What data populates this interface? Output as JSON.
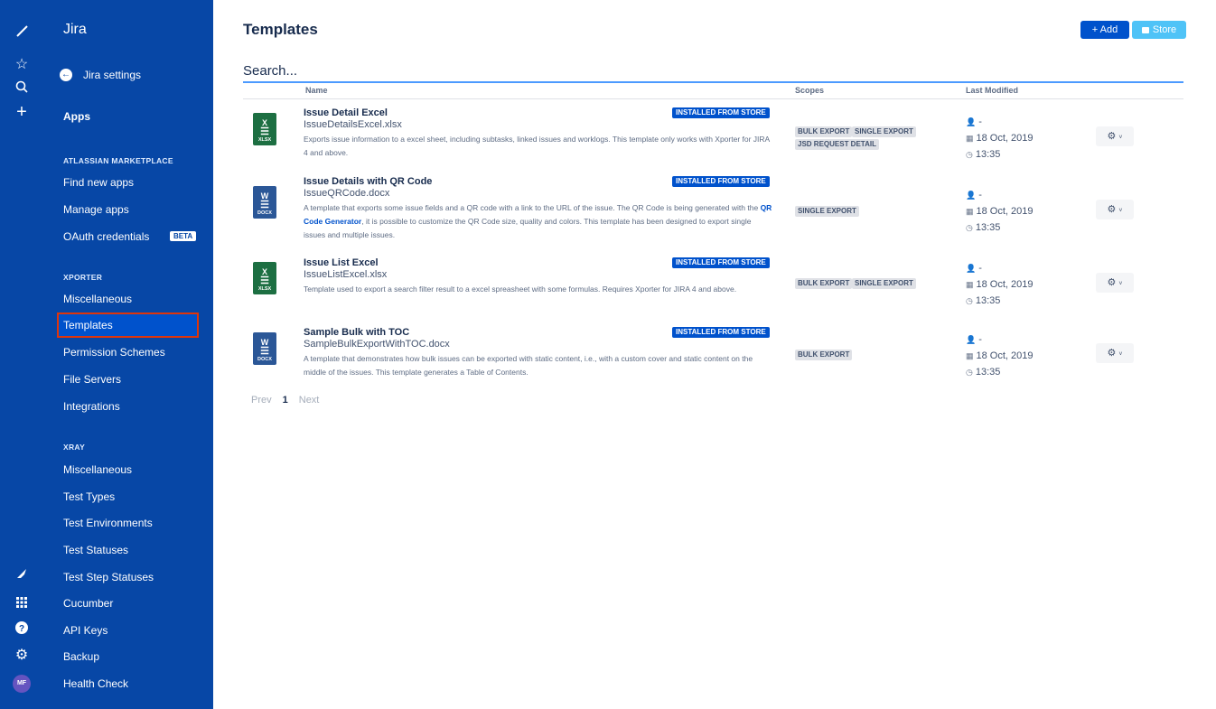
{
  "rail": {
    "icons": [
      "jira-logo-icon",
      "star-icon",
      "search-icon",
      "plus-icon",
      "rocket-icon",
      "app-grid-icon",
      "help-icon",
      "settings-icon"
    ],
    "avatar": "MF"
  },
  "sidebar": {
    "brand": "Jira",
    "back_label": "Jira settings",
    "apps": "Apps",
    "sections": [
      {
        "heading": "ATLASSIAN MARKETPLACE",
        "items": [
          "Find new apps",
          "Manage apps",
          "OAuth credentials"
        ]
      },
      {
        "heading": "XPORTER",
        "items": [
          "Miscellaneous",
          "Templates",
          "Permission Schemes",
          "File Servers",
          "Integrations"
        ]
      },
      {
        "heading": "XRAY",
        "items": [
          "Miscellaneous",
          "Test Types",
          "Test Environments",
          "Test Statuses",
          "Test Step Statuses",
          "Cucumber",
          "API Keys",
          "Backup",
          "Health Check"
        ]
      }
    ],
    "beta_badge": "BETA",
    "selected": "Templates"
  },
  "main": {
    "title": "Templates",
    "add_label": "+ Add",
    "store_label": "Store",
    "search_placeholder": "Search...",
    "columns": [
      "Name",
      "Scopes",
      "Last Modified"
    ],
    "rows": [
      {
        "name": "Issue Detail Excel",
        "file": "IssueDetailsExcel.xlsx",
        "type": "xlsx",
        "ext": "XLSX",
        "badge": "INSTALLED FROM STORE",
        "desc": "Exports issue information to a excel sheet, including subtasks, linked issues and worklogs. This template only works with Xporter for JIRA 4 and above.",
        "scopes": [
          "BULK EXPORT",
          "SINGLE EXPORT",
          "JSD REQUEST DETAIL"
        ],
        "user": "-",
        "date": "18 Oct, 2019",
        "time": "13:35"
      },
      {
        "name": "Issue Details with QR Code",
        "file": "IssueQRCode.docx",
        "type": "docx",
        "ext": "DOCX",
        "badge": "INSTALLED FROM STORE",
        "desc_pre": "A template that exports some issue fields and a QR code with a link to the URL of the issue. The QR Code is being generated with the ",
        "desc_link": "QR Code Generator",
        "desc_post": ", it is possible to customize the QR Code size, quality and colors. This template has been designed to export single issues and multiple issues.",
        "scopes": [
          "SINGLE EXPORT"
        ],
        "user": "-",
        "date": "18 Oct, 2019",
        "time": "13:35"
      },
      {
        "name": "Issue List Excel",
        "file": "IssueListExcel.xlsx",
        "type": "xlsx",
        "ext": "XLSX",
        "badge": "INSTALLED FROM STORE",
        "desc": "Template used to export a search filter result to a excel spreasheet with some formulas. Requires Xporter for JIRA 4 and above.",
        "scopes": [
          "BULK EXPORT",
          "SINGLE EXPORT"
        ],
        "user": "-",
        "date": "18 Oct, 2019",
        "time": "13:35"
      },
      {
        "name": "Sample Bulk with TOC",
        "file": "SampleBulkExportWithTOC.docx",
        "type": "docx",
        "ext": "DOCX",
        "badge": "INSTALLED FROM STORE",
        "desc": "A template that demonstrates how bulk issues can be exported with static content, i.e., with a custom cover and static content on the middle of the issues. This template generates a Table of Contents.",
        "scopes": [
          "BULK EXPORT"
        ],
        "user": "-",
        "date": "18 Oct, 2019",
        "time": "13:35"
      }
    ],
    "pager": {
      "prev": "Prev",
      "current": "1",
      "next": "Next"
    }
  }
}
